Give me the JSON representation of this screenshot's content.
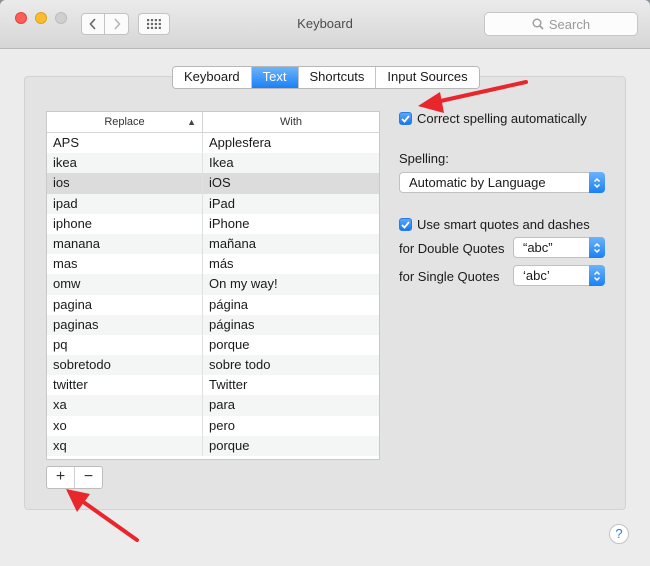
{
  "window": {
    "title": "Keyboard"
  },
  "search": {
    "placeholder": "Search"
  },
  "tabs": [
    {
      "label": "Keyboard",
      "active": false
    },
    {
      "label": "Text",
      "active": true
    },
    {
      "label": "Shortcuts",
      "active": false
    },
    {
      "label": "Input Sources",
      "active": false
    }
  ],
  "table": {
    "headers": {
      "replace": "Replace",
      "with": "With"
    },
    "selected_row": 2,
    "rows": [
      {
        "replace": "APS",
        "with": "Applesfera"
      },
      {
        "replace": "ikea",
        "with": "Ikea"
      },
      {
        "replace": "ios",
        "with": "iOS"
      },
      {
        "replace": "ipad",
        "with": "iPad"
      },
      {
        "replace": "iphone",
        "with": "iPhone"
      },
      {
        "replace": "manana",
        "with": "mañana"
      },
      {
        "replace": "mas",
        "with": "más"
      },
      {
        "replace": "omw",
        "with": "On my way!"
      },
      {
        "replace": "pagina",
        "with": "página"
      },
      {
        "replace": "paginas",
        "with": "páginas"
      },
      {
        "replace": "pq",
        "with": "porque"
      },
      {
        "replace": "sobretodo",
        "with": "sobre todo"
      },
      {
        "replace": "twitter",
        "with": "Twitter"
      },
      {
        "replace": "xa",
        "with": "para"
      },
      {
        "replace": "xo",
        "with": "pero"
      },
      {
        "replace": "xq",
        "with": "porque"
      }
    ]
  },
  "buttons": {
    "add": "+",
    "remove": "−"
  },
  "options": {
    "correct_spelling": {
      "label": "Correct spelling automatically",
      "checked": true
    },
    "spelling_label": "Spelling:",
    "spelling_value": "Automatic by Language",
    "smart_quotes": {
      "label": "Use smart quotes and dashes",
      "checked": true
    },
    "double_quotes_label": "for Double Quotes",
    "double_quotes_value": "“abc”",
    "single_quotes_label": "for Single Quotes",
    "single_quotes_value": "‘abc’"
  },
  "help": "?",
  "colors": {
    "accent": "#1a81f4",
    "annotation_arrow": "#e8262b"
  }
}
